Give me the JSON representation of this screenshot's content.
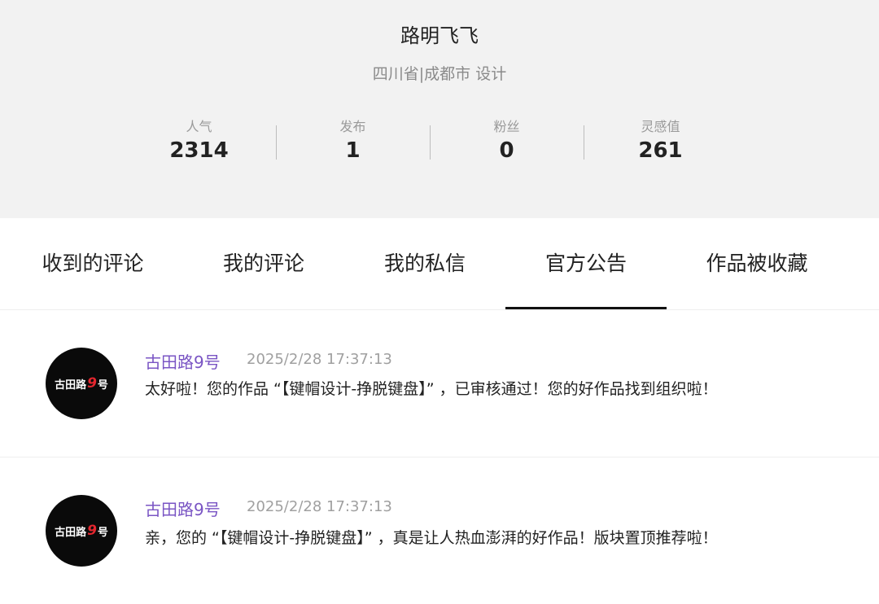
{
  "profile": {
    "name": "路明飞飞",
    "location": "四川省|成都市 设计",
    "stats": [
      {
        "label": "人气",
        "value": "2314"
      },
      {
        "label": "发布",
        "value": "1"
      },
      {
        "label": "粉丝",
        "value": "0"
      },
      {
        "label": "灵感值",
        "value": "261"
      }
    ]
  },
  "tabs": [
    {
      "label": "收到的评论",
      "active": false
    },
    {
      "label": "我的评论",
      "active": false
    },
    {
      "label": "我的私信",
      "active": false
    },
    {
      "label": "官方公告",
      "active": true
    },
    {
      "label": "作品被收藏",
      "active": false
    }
  ],
  "notices": [
    {
      "avatar_text_before": "古田路",
      "avatar_text_num": "9",
      "avatar_text_after": "号",
      "sender": "古田路9号",
      "time": "2025/2/28 17:37:13",
      "message": "太好啦！您的作品 “【键帽设计-挣脱键盘】” ，已审核通过！您的好作品找到组织啦！"
    },
    {
      "avatar_text_before": "古田路",
      "avatar_text_num": "9",
      "avatar_text_after": "号",
      "sender": "古田路9号",
      "time": "2025/2/28 17:37:13",
      "message": "亲，您的 “【键帽设计-挣脱键盘】” ，真是让人热血澎湃的好作品！版块置顶推荐啦！"
    }
  ],
  "colors": {
    "sender": "#7a55c4",
    "avatar_accent": "#e3262e",
    "profile_bg": "#f2f2f2"
  }
}
